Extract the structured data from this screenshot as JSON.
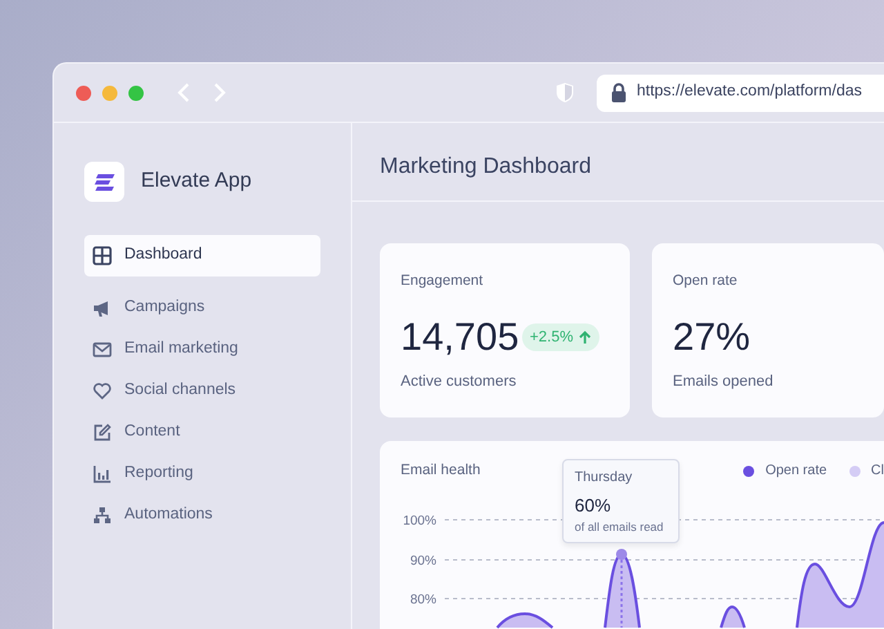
{
  "browser": {
    "url": "https://elevate.com/platform/das"
  },
  "sidebar": {
    "app_name": "Elevate App",
    "items": [
      {
        "label": "Dashboard",
        "selected": true
      },
      {
        "label": "Campaigns",
        "selected": false
      },
      {
        "label": "Email marketing",
        "selected": false
      },
      {
        "label": "Social channels",
        "selected": false
      },
      {
        "label": "Content",
        "selected": false
      },
      {
        "label": "Reporting",
        "selected": false
      },
      {
        "label": "Automations",
        "selected": false
      }
    ]
  },
  "header": {
    "title": "Marketing Dashboard"
  },
  "stats": [
    {
      "title": "Engagement",
      "value": "14,705",
      "caption": "Active customers",
      "delta": "+2.5%"
    },
    {
      "title": "Open rate",
      "value": "27%",
      "caption": "Emails opened"
    }
  ],
  "email_health": {
    "title": "Email health",
    "legend": [
      {
        "label": "Open rate",
        "color": "#6a4fe0"
      },
      {
        "label": "Cl",
        "color": "#d4ccf5"
      }
    ],
    "y_labels": [
      "100%",
      "90%",
      "80%"
    ],
    "tooltip": {
      "day": "Thursday",
      "value": "60%",
      "caption": "of all emails read"
    }
  }
}
